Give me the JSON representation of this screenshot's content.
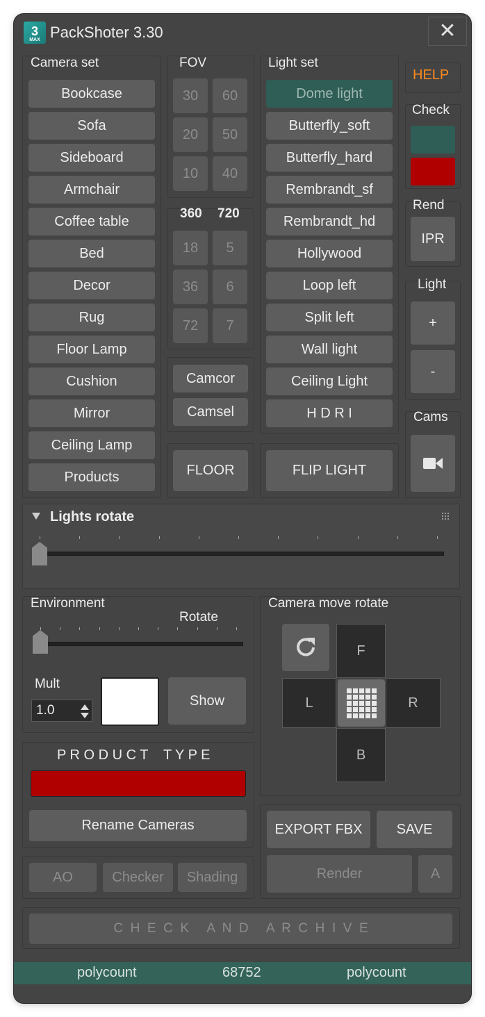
{
  "window": {
    "title": "PackShoter 3.30",
    "icon_label": "3",
    "icon_sub": "MAX"
  },
  "camera_set": {
    "label": "Camera set",
    "items": [
      "Bookcase",
      "Sofa",
      "Sideboard",
      "Armchair",
      "Coffee table",
      "Bed",
      "Decor",
      "Rug",
      "Floor Lamp",
      "Cushion",
      "Mirror",
      "Ceiling Lamp",
      "Products"
    ]
  },
  "fov": {
    "label": "FOV",
    "values": [
      "30",
      "60",
      "20",
      "50",
      "10",
      "40"
    ]
  },
  "frames": {
    "label_a": "360",
    "label_b": "720",
    "values": [
      "18",
      "5",
      "36",
      "6",
      "72",
      "7"
    ]
  },
  "cam_tools": {
    "camcor": "Camcor",
    "camsel": "Camsel"
  },
  "light_set": {
    "label": "Light set",
    "items": [
      "Dome light",
      "Butterfly_soft",
      "Butterfly_hard",
      "Rembrandt_sf",
      "Rembrandt_hd",
      "Hollywood",
      "Loop left",
      "Split left",
      "Wall light",
      "Ceiling Light",
      "H D R I"
    ]
  },
  "side": {
    "help": "HELP",
    "check_label": "Check",
    "check_colors": [
      "#2e5e56",
      "#b00000"
    ],
    "rend_label": "Rend",
    "ipr": "IPR",
    "light_label": "Light",
    "plus": "+",
    "minus": "-",
    "cams_label": "Cams"
  },
  "floor_btn": "FLOOR",
  "flip_light_btn": "FLIP LIGHT",
  "lights_rotate": {
    "label": "Lights rotate",
    "position": 0
  },
  "environment": {
    "label": "Environment",
    "rotate_label": "Rotate",
    "rotate_position": 0,
    "mult_label": "Mult",
    "mult_value": "1.0",
    "color": "#ffffff",
    "show": "Show"
  },
  "camera_move": {
    "label": "Camera move rotate",
    "f": "F",
    "l": "L",
    "r": "R",
    "b": "B"
  },
  "product_type": {
    "label": "P R O D U C T    T Y P E",
    "color": "#b00000"
  },
  "rename_cameras": "Rename Cameras",
  "view_modes": [
    "AO",
    "Checker",
    "Shading"
  ],
  "export": {
    "fbx": "EXPORT FBX",
    "save": "SAVE",
    "render": "Render",
    "a": "A"
  },
  "check_archive": "C  H  E  C  K     A  N  D     A  R  C  H  I  V  E",
  "status": {
    "left": "polycount",
    "value": "68752",
    "right": "polycount"
  }
}
